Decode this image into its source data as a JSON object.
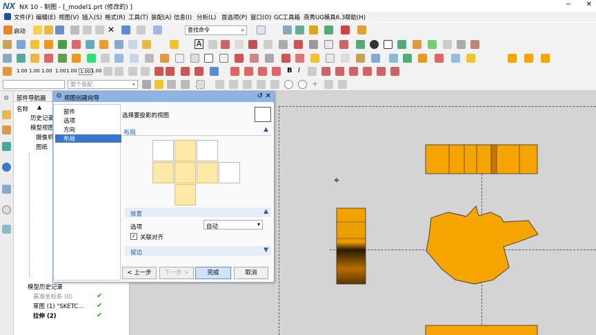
{
  "window": {
    "logo": "NX",
    "title": "NX 10 - 制图 - [_model1.prt  (修改的)  ]"
  },
  "menu": [
    "文件(F)",
    "编辑(E)",
    "视图(V)",
    "插入(S)",
    "格式(R)",
    "工具(T)",
    "装配(A)",
    "信息(I)",
    "分析(L)",
    "首选项(P)",
    "窗口(O)",
    "GC工具箱",
    "燕秀UG模具6.3",
    "帮助(H)"
  ],
  "toolbar": {
    "start_label": "启动",
    "search_placeholder": "查找命令",
    "filter_placeholder": "整个装配",
    "dim_labels": [
      "1.00",
      "1.00",
      "1.00",
      "1.00",
      "1.00",
      "1.00",
      "1.00"
    ]
  },
  "navigator": {
    "title": "部件导航器",
    "col_name": "名称",
    "items": [
      "历史记录",
      "模型视图",
      "摄像机",
      "图纸",
      "模型历史记录",
      "基准坐标系 (0)",
      "草图 (1) \"SKETC...",
      "拉伸 (2)"
    ]
  },
  "dialog": {
    "title": "视图创建向导",
    "list": [
      "部件",
      "选项",
      "方向",
      "布局"
    ],
    "prompt": "选择要投影的视图",
    "section_layout": "布局",
    "section_place": "放置",
    "option_label": "选项",
    "option_value": "自动",
    "checkbox_label": "关联对齐",
    "section_margin": "留边",
    "btn_back": "< 上一步",
    "btn_next": "下一步 >",
    "btn_finish": "完成",
    "btn_cancel": "取消"
  },
  "colors": {
    "part_fill": "#f5a400",
    "part_stroke": "#333",
    "canvas": "#d4d4d4",
    "accent": "#3877c9"
  }
}
